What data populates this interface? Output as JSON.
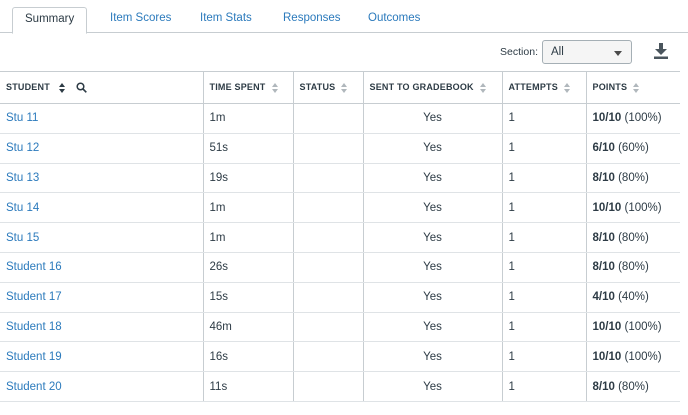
{
  "tabs": [
    {
      "label": "Summary",
      "active": true
    },
    {
      "label": "Item Scores",
      "active": false
    },
    {
      "label": "Item Stats",
      "active": false
    },
    {
      "label": "Responses",
      "active": false
    },
    {
      "label": "Outcomes",
      "active": false
    }
  ],
  "section": {
    "label": "Section:",
    "value": "All"
  },
  "icons": {
    "download": "download-icon",
    "search": "search-icon",
    "sort": "sort-icon"
  },
  "colors": {
    "link": "#2b7abc",
    "text": "#2d3b45",
    "border": "#c7cdd1"
  },
  "table": {
    "headers": [
      "STUDENT",
      "TIME SPENT",
      "STATUS",
      "SENT TO GRADEBOOK",
      "ATTEMPTS",
      "POINTS"
    ],
    "rows": [
      {
        "student": "Stu 11",
        "time": "1m",
        "status": "",
        "gradebook": "Yes",
        "attempts": "1",
        "points": "10/10",
        "percent": "(100%)"
      },
      {
        "student": "Stu 12",
        "time": "51s",
        "status": "",
        "gradebook": "Yes",
        "attempts": "1",
        "points": "6/10",
        "percent": "(60%)"
      },
      {
        "student": "Stu 13",
        "time": "19s",
        "status": "",
        "gradebook": "Yes",
        "attempts": "1",
        "points": "8/10",
        "percent": "(80%)"
      },
      {
        "student": "Stu 14",
        "time": "1m",
        "status": "",
        "gradebook": "Yes",
        "attempts": "1",
        "points": "10/10",
        "percent": "(100%)"
      },
      {
        "student": "Stu 15",
        "time": "1m",
        "status": "",
        "gradebook": "Yes",
        "attempts": "1",
        "points": "8/10",
        "percent": "(80%)"
      },
      {
        "student": "Student 16",
        "time": "26s",
        "status": "",
        "gradebook": "Yes",
        "attempts": "1",
        "points": "8/10",
        "percent": "(80%)"
      },
      {
        "student": "Student 17",
        "time": "15s",
        "status": "",
        "gradebook": "Yes",
        "attempts": "1",
        "points": "4/10",
        "percent": "(40%)"
      },
      {
        "student": "Student 18",
        "time": "46m",
        "status": "",
        "gradebook": "Yes",
        "attempts": "1",
        "points": "10/10",
        "percent": "(100%)"
      },
      {
        "student": "Student 19",
        "time": "16s",
        "status": "",
        "gradebook": "Yes",
        "attempts": "1",
        "points": "10/10",
        "percent": "(100%)"
      },
      {
        "student": "Student 20",
        "time": "11s",
        "status": "",
        "gradebook": "Yes",
        "attempts": "1",
        "points": "8/10",
        "percent": "(80%)"
      }
    ]
  }
}
